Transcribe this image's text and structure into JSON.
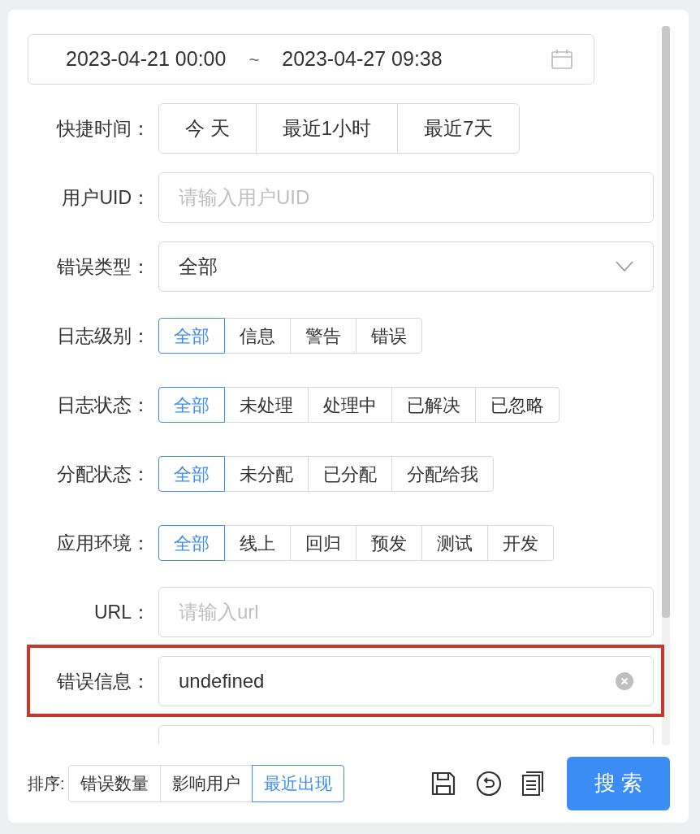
{
  "date_range": {
    "start": "2023-04-21 00:00",
    "separator": "~",
    "end": "2023-04-27 09:38"
  },
  "form": [
    {
      "kind": "buttons",
      "label": "快捷时间：",
      "options": [
        {
          "label": "今 天"
        },
        {
          "label": "最近1小时"
        },
        {
          "label": "最近7天"
        }
      ]
    },
    {
      "kind": "input",
      "label": "用户UID：",
      "placeholder": "请输入用户UID"
    },
    {
      "kind": "select",
      "label": "错误类型：",
      "value": "全部"
    },
    {
      "kind": "radio",
      "label": "日志级别：",
      "options": [
        {
          "label": "全部",
          "selected": true
        },
        {
          "label": "信息",
          "selected": false
        },
        {
          "label": "警告",
          "selected": false
        },
        {
          "label": "错误",
          "selected": false
        }
      ]
    },
    {
      "kind": "radio",
      "label": "日志状态：",
      "options": [
        {
          "label": "全部",
          "selected": true
        },
        {
          "label": "未处理",
          "selected": false
        },
        {
          "label": "处理中",
          "selected": false
        },
        {
          "label": "已解决",
          "selected": false
        },
        {
          "label": "已忽略",
          "selected": false
        }
      ]
    },
    {
      "kind": "radio",
      "label": "分配状态：",
      "options": [
        {
          "label": "全部",
          "selected": true
        },
        {
          "label": "未分配",
          "selected": false
        },
        {
          "label": "已分配",
          "selected": false
        },
        {
          "label": "分配给我",
          "selected": false
        }
      ]
    },
    {
      "kind": "radio",
      "label": "应用环境：",
      "options": [
        {
          "label": "全部",
          "selected": true
        },
        {
          "label": "线上",
          "selected": false
        },
        {
          "label": "回归",
          "selected": false
        },
        {
          "label": "预发",
          "selected": false
        },
        {
          "label": "测试",
          "selected": false
        },
        {
          "label": "开发",
          "selected": false
        }
      ]
    },
    {
      "kind": "input",
      "label": "URL：",
      "placeholder": "请输入url"
    },
    {
      "kind": "input",
      "label": "错误信息：",
      "value": "undefined",
      "highlighted": true
    },
    {
      "kind": "input"
    }
  ],
  "sort": {
    "label": "排序:",
    "options": [
      {
        "label": "错误数量",
        "selected": false
      },
      {
        "label": "影响用户",
        "selected": false
      },
      {
        "label": "最近出现",
        "selected": true
      }
    ]
  },
  "search_button": "搜 索"
}
